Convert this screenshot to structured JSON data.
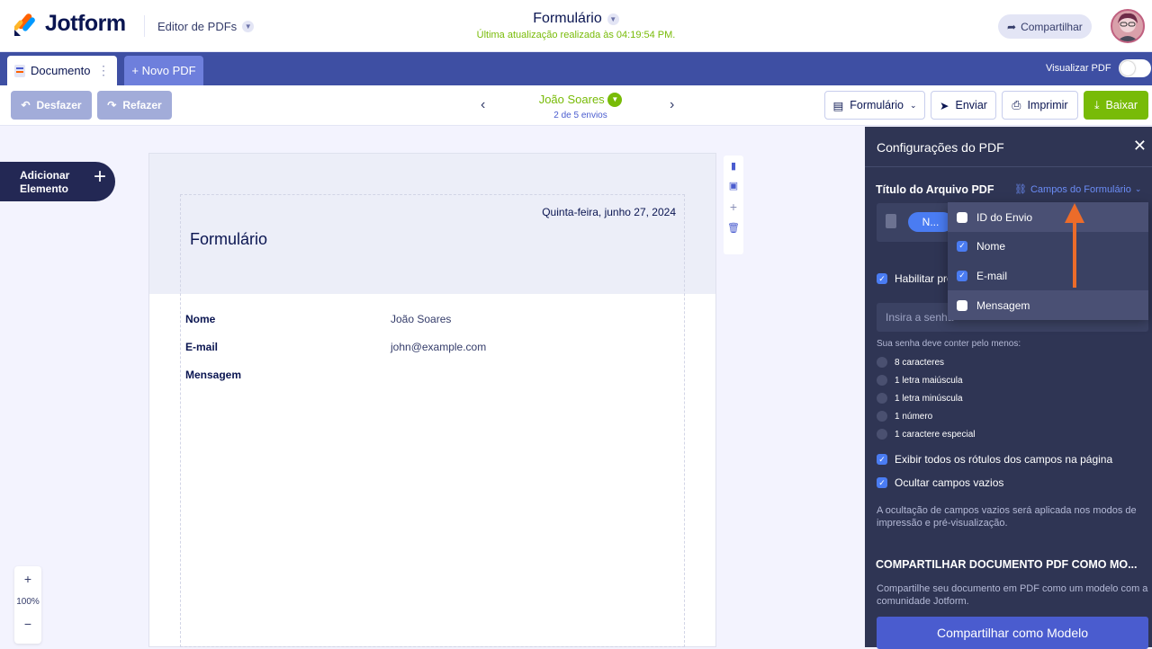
{
  "header": {
    "brand": "Jotform",
    "editor_label": "Editor de PDFs",
    "form_title": "Formulário",
    "last_update": "Última atualização realizada às 04:19:54 PM.",
    "share_label": "Compartilhar"
  },
  "tabs": {
    "document": "Documento",
    "new_pdf": "+ Novo PDF",
    "preview_label": "Visualizar PDF"
  },
  "toolbar": {
    "undo": "Desfazer",
    "redo": "Refazer",
    "submitter": "João Soares",
    "submission_count": "2 de 5 envios",
    "form_menu": "Formulário",
    "send": "Enviar",
    "print": "Imprimir",
    "download": "Baixar"
  },
  "left": {
    "add_element": "Adicionar Elemento",
    "zoom_in": "+",
    "zoom_level": "100%",
    "zoom_out": "−"
  },
  "document": {
    "date": "Quinta-feira, junho 27, 2024",
    "title": "Formulário",
    "fields": [
      {
        "label": "Nome",
        "value": "João Soares"
      },
      {
        "label": "E-mail",
        "value": "john@example.com"
      },
      {
        "label": "Mensagem",
        "value": ""
      }
    ]
  },
  "panel": {
    "title": "Configurações do PDF",
    "file_title_label": "Título do Arquivo PDF",
    "form_fields_link": "Campos do Formulário",
    "title_pill": "N...",
    "enable_protection": "Habilitar pro",
    "password_placeholder": "Insira a senha",
    "password_rules_title": "Sua senha deve conter pelo menos:",
    "password_rules": [
      "8 caracteres",
      "1 letra maiúscula",
      "1 letra minúscula",
      "1 número",
      "1 caractere especial"
    ],
    "show_labels": "Exibir todos os rótulos dos campos na página",
    "hide_empty": "Ocultar campos vazios",
    "hide_empty_note": "A ocultação de campos vazios será aplicada nos modos de impressão e pré-visualização.",
    "share_title": "COMPARTILHAR DOCUMENTO PDF COMO MO...",
    "share_desc": "Compartilhe seu documento em PDF como um modelo com a comunidade Jotform.",
    "share_button": "Compartilhar como Modelo",
    "dropdown": [
      {
        "label": "ID do Envio",
        "checked": false
      },
      {
        "label": "Nome",
        "checked": true
      },
      {
        "label": "E-mail",
        "checked": true
      },
      {
        "label": "Mensagem",
        "checked": false
      }
    ]
  },
  "colors": {
    "accent": "#4a5ccf",
    "green": "#78bb07",
    "navy": "#0a1551",
    "panel": "#2f3554",
    "tabbar": "#3e4fa3",
    "arrow": "#ec6c2a"
  }
}
